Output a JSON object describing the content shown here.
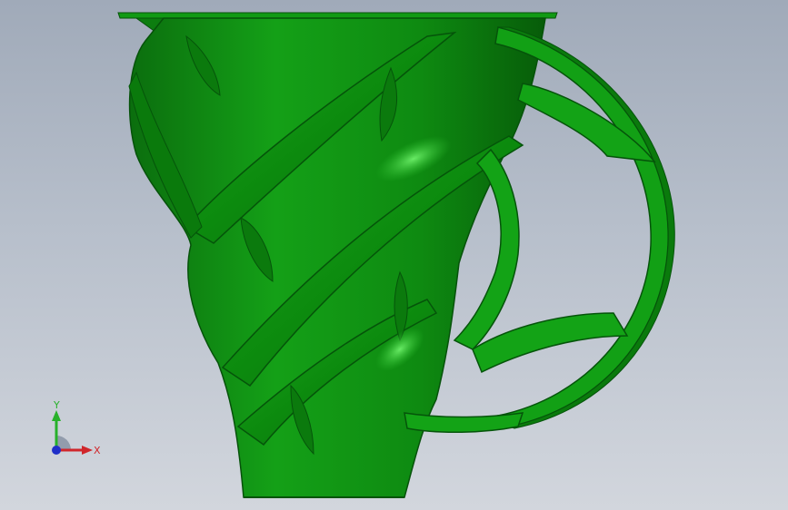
{
  "viewport": {
    "background_top": "#a0aab9",
    "background_bottom": "#d2d6dd"
  },
  "model": {
    "part_color": "#0f8a12",
    "part_edge_color": "#05540a",
    "highlight_color": "#5fe05a",
    "description_icon": "helical-impeller-model"
  },
  "triad": {
    "y_label": "Y",
    "x_label": "X",
    "y_color": "#27b12a",
    "x_color": "#d0262b",
    "z_color": "#1f2fc8"
  }
}
